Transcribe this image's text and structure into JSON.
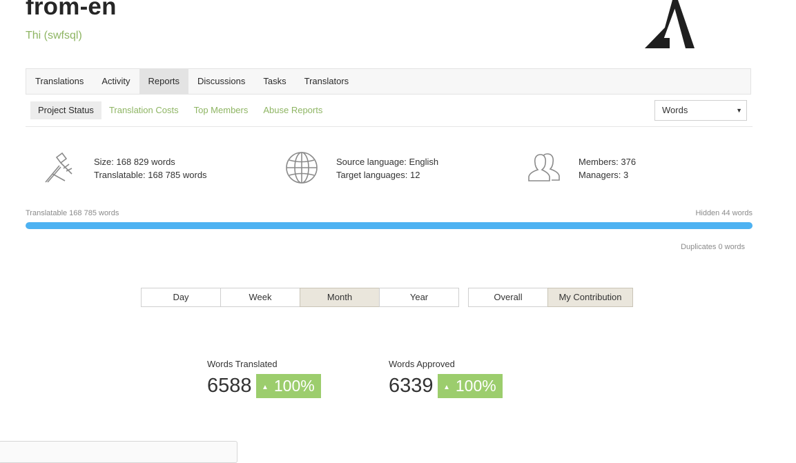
{
  "project": {
    "title": "from-en",
    "subtitle": "Thi (swfsql)"
  },
  "tabs": [
    {
      "label": "Translations"
    },
    {
      "label": "Activity"
    },
    {
      "label": "Reports",
      "active": true
    },
    {
      "label": "Discussions"
    },
    {
      "label": "Tasks"
    },
    {
      "label": "Translators"
    }
  ],
  "subtabs": [
    {
      "label": "Project Status",
      "active": true
    },
    {
      "label": "Translation Costs"
    },
    {
      "label": "Top Members"
    },
    {
      "label": "Abuse Reports"
    }
  ],
  "unit_select": {
    "value": "Words"
  },
  "stats": {
    "size": {
      "icon": "compass-tools-icon",
      "line1": "Size: 168 829 words",
      "line2": "Translatable: 168 785 words"
    },
    "languages": {
      "icon": "globe-icon",
      "line1": "Source language: English",
      "line2": "Target languages: 12"
    },
    "members": {
      "icon": "users-icon",
      "line1": "Members: 376",
      "line2": "Managers: 3"
    }
  },
  "progress": {
    "left_label": "Translatable 168 785 words",
    "right_label": "Hidden 44 words",
    "duplicates_label": "Duplicates 0 words",
    "translatable_fraction": 0.9997
  },
  "period_buttons": [
    {
      "label": "Day"
    },
    {
      "label": "Week"
    },
    {
      "label": "Month",
      "active": true
    },
    {
      "label": "Year"
    }
  ],
  "scope_buttons": [
    {
      "label": "Overall"
    },
    {
      "label": "My Contribution",
      "active": true
    }
  ],
  "metrics": {
    "translated": {
      "label": "Words Translated",
      "value": "6588",
      "change": "100%"
    },
    "approved": {
      "label": "Words Approved",
      "value": "6339",
      "change": "100%"
    }
  },
  "colors": {
    "accent_green": "#8eb563",
    "progress_blue": "#4db2f2",
    "badge_green": "#9ccd6d"
  }
}
